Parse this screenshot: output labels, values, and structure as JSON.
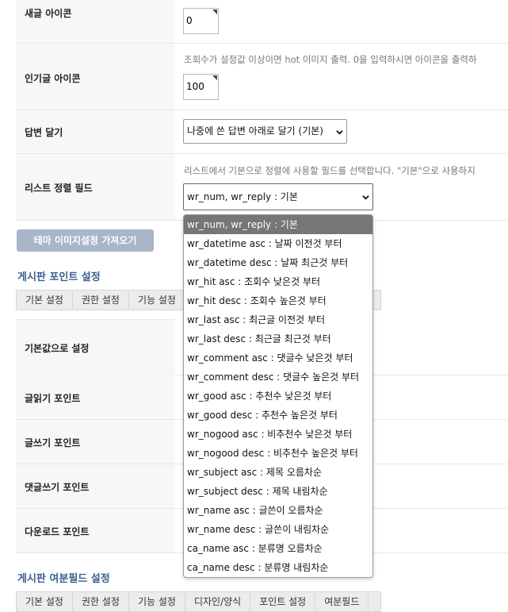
{
  "rows": {
    "new_icon": {
      "label": "새글 아이콘",
      "value": "0"
    },
    "hot_icon": {
      "label": "인기글 아이콘",
      "help": "조회수가 설정값 이상이면 hot 이미지 출력. 0을 입력하시면 아이콘을 출력하",
      "value": "100"
    },
    "reply": {
      "label": "답변 달기",
      "selected": "나중에 쓴 답변 아래로 달기 (기본)"
    },
    "sort": {
      "label": "리스트 정렬 필드",
      "help": "리스트에서 기본으로 정렬에 사용할 필드를 선택합니다. \"기본\"으로 사용하지",
      "selected": "wr_num, wr_reply : 기본"
    }
  },
  "theme_button": "테마 이미지설정 가져오기",
  "point_section": {
    "title": "게시판 포인트 설정",
    "tabs": [
      "기본 설정",
      "권한 설정",
      "기능 설정"
    ],
    "rows": [
      "기본값으로 설정",
      "글읽기 포인트",
      "글쓰기 포인트",
      "댓글쓰기 포인트",
      "다운로드 포인트"
    ]
  },
  "extra_section": {
    "title": "게시판 여분필드 설정",
    "tabs": [
      "기본 설정",
      "권한 설정",
      "기능 설정",
      "디자인/양식",
      "포인트 설정",
      "여분필드"
    ]
  },
  "sort_options": [
    "wr_num, wr_reply : 기본",
    "wr_datetime asc : 날짜 이전것 부터",
    "wr_datetime desc : 날짜 최근것 부터",
    "wr_hit asc : 조회수 낮은것 부터",
    "wr_hit desc : 조회수 높은것 부터",
    "wr_last asc : 최근글 이전것 부터",
    "wr_last desc : 최근글 최근것 부터",
    "wr_comment asc : 댓글수 낮은것 부터",
    "wr_comment desc : 댓글수 높은것 부터",
    "wr_good asc : 추천수 낮은것 부터",
    "wr_good desc : 추천수 높은것 부터",
    "wr_nogood asc : 비추천수 낮은것 부터",
    "wr_nogood desc : 비추천수 높은것 부터",
    "wr_subject asc : 제목 오름차순",
    "wr_subject desc : 제목 내림차순",
    "wr_name asc : 글쓴이 오름차순",
    "wr_name desc : 글쓴이 내림차순",
    "ca_name asc : 분류명 오름차순",
    "ca_name desc : 분류명 내림차순"
  ],
  "colors": {
    "section_title": "#3a5f8f",
    "button": "#a9b5c9",
    "selected_option": "#767676"
  },
  "icons": {
    "select_arrow": "chevron-down-icon",
    "spinner": "spinner-corner-icon"
  }
}
